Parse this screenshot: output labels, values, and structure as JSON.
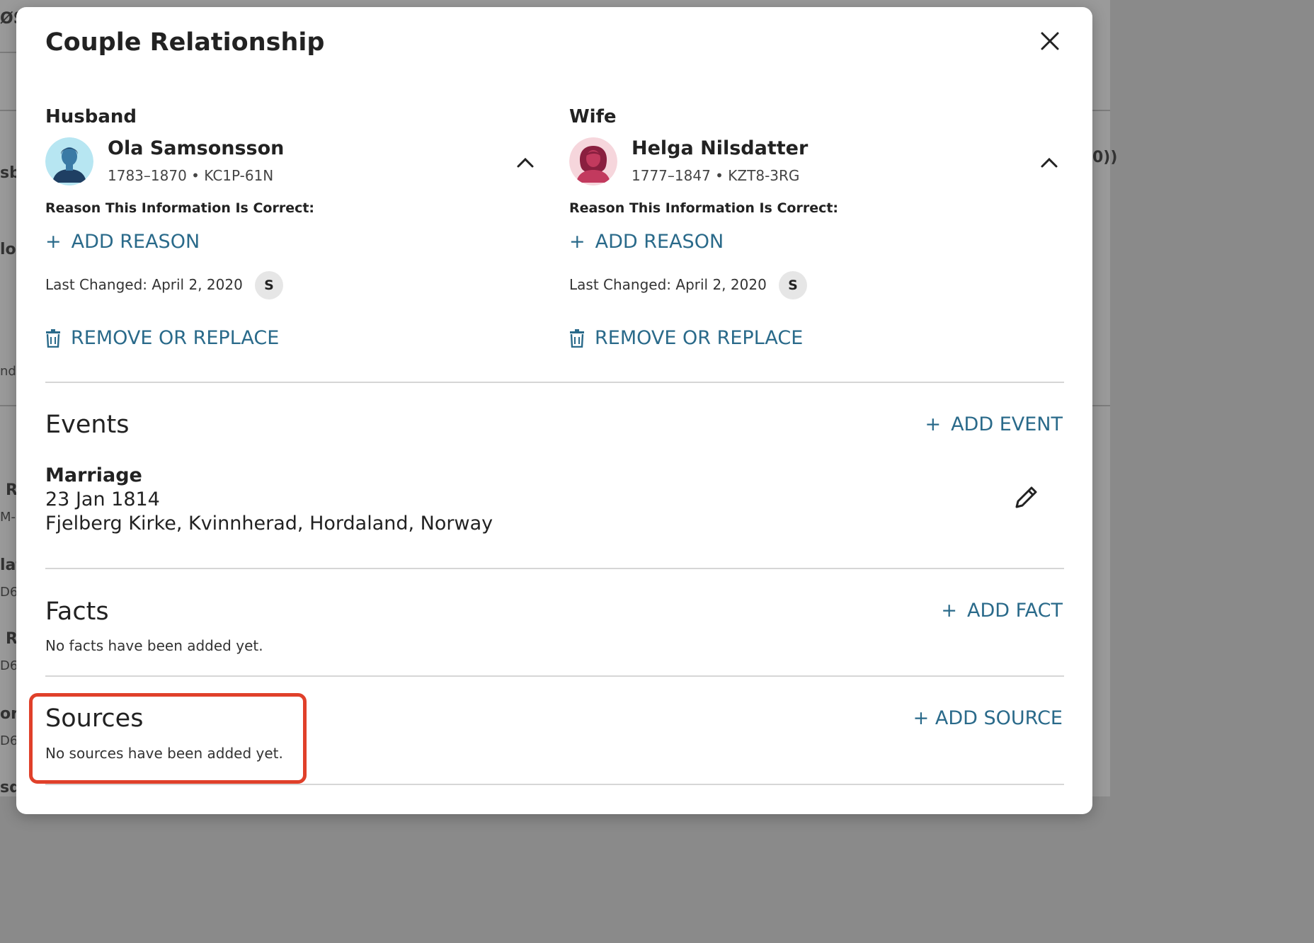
{
  "background": {
    "fragments": [
      "ØS",
      "sb",
      "lo",
      "nd,",
      "R",
      "M-",
      "lat",
      "D6",
      "R",
      "D6",
      "or",
      "D6",
      "sd",
      "0))"
    ]
  },
  "modal": {
    "title": "Couple Relationship",
    "close_icon": "close-icon"
  },
  "husband": {
    "role": "Husband",
    "name": "Ola Samsonsson",
    "meta": "1783–1870 • KC1P-61N",
    "reason_label": "Reason This Information Is Correct:",
    "add_reason": "ADD REASON",
    "last_changed": "Last Changed: April 2, 2020",
    "user_initial": "S",
    "remove_label": "REMOVE OR REPLACE",
    "avatar_bg": "#b7e6f2",
    "avatar_color": "#2f5b86"
  },
  "wife": {
    "role": "Wife",
    "name": "Helga Nilsdatter",
    "meta": "1777–1847 • KZT8-3RG",
    "reason_label": "Reason This Information Is Correct:",
    "add_reason": "ADD REASON",
    "last_changed": "Last Changed: April 2, 2020",
    "user_initial": "S",
    "remove_label": "REMOVE OR REPLACE",
    "avatar_bg": "#f6d6dc",
    "avatar_color": "#c23a5e"
  },
  "events": {
    "title": "Events",
    "add_label": "ADD EVENT",
    "items": [
      {
        "type": "Marriage",
        "date": "23 Jan 1814",
        "place": "Fjelberg Kirke, Kvinnherad, Hordaland, Norway"
      }
    ]
  },
  "facts": {
    "title": "Facts",
    "add_label": "ADD FACT",
    "empty": "No facts have been added yet."
  },
  "sources": {
    "title": "Sources",
    "add_label": "+ ADD SOURCE",
    "empty": "No sources have been added yet."
  },
  "colors": {
    "link": "#2a6a8a",
    "highlight": "#e0402a"
  }
}
